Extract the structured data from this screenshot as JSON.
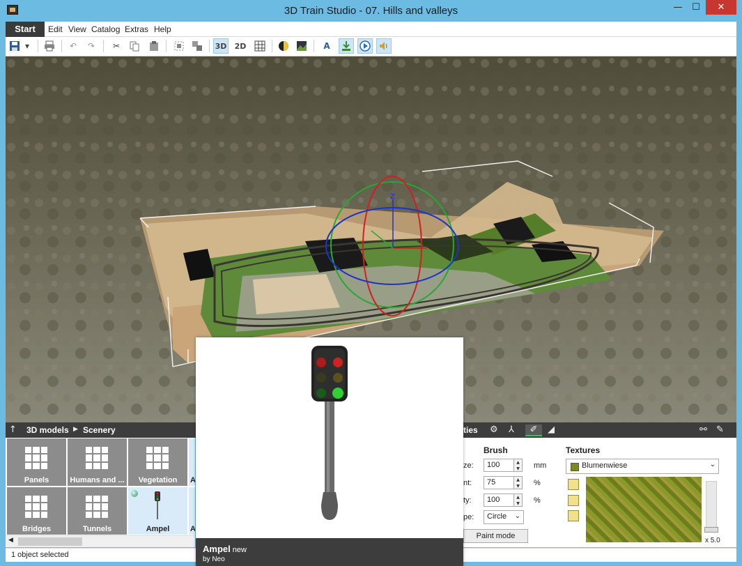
{
  "window": {
    "title": "3D Train Studio - 07. Hills and valleys",
    "min_glyph": "—",
    "max_glyph": "☐",
    "close_glyph": "✕"
  },
  "menubar": {
    "start": "Start",
    "items": [
      "Edit",
      "View",
      "Catalog",
      "Extras",
      "Help"
    ]
  },
  "toolbar": {
    "view_3d": "3D",
    "view_2d": "2D"
  },
  "viewport": {
    "axis_label": "Z"
  },
  "panel": {
    "breadcrumb": [
      "3D models",
      "Scenery"
    ],
    "properties_partial": "ties"
  },
  "catalog": {
    "tiles": [
      "Panels",
      "Humans and ...",
      "Vegetation",
      "Bridges",
      "Tunnels",
      "Ampel"
    ],
    "partial_tiles": [
      "A",
      "A"
    ]
  },
  "brush": {
    "title": "Brush",
    "size": {
      "label": "ze:",
      "value": "100",
      "unit": "mm"
    },
    "strength": {
      "label": "nt:",
      "value": "75",
      "unit": "%"
    },
    "density": {
      "label": "ty:",
      "value": "100",
      "unit": "%"
    },
    "shape": {
      "label": "pe:",
      "value": "Circle"
    },
    "paint_mode": "Paint mode"
  },
  "textures": {
    "title": "Textures",
    "selected": "Blumenwiese",
    "zoom": "x 5.0"
  },
  "popup": {
    "name": "Ampel",
    "badge": "new",
    "author": "by Neo"
  },
  "status": {
    "text": "1 object selected"
  },
  "colors": {
    "accent": "#3a3a3a",
    "title_bar": "#6bbbe3",
    "close": "#c7372f"
  }
}
